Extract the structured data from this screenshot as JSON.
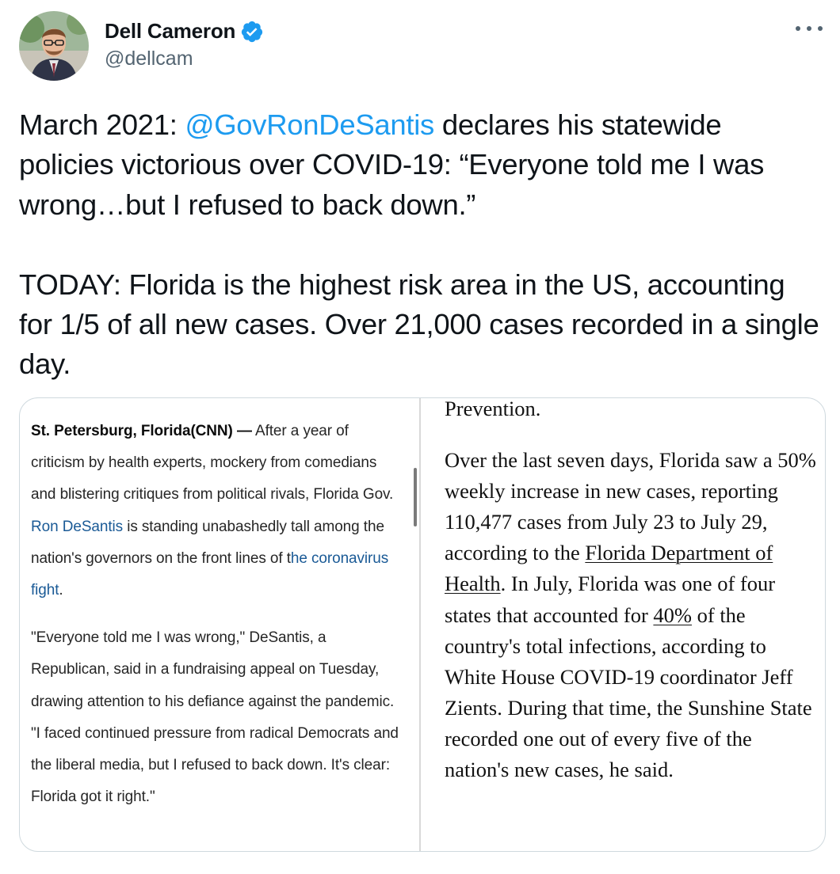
{
  "author": {
    "display_name": "Dell Cameron",
    "handle": "@dellcam",
    "verified": true,
    "avatar_icon": "avatar-photo"
  },
  "tweet": {
    "paragraph1": {
      "lead": "March 2021: ",
      "mention": "@GovRonDeSantis",
      "rest": " declares his statewide policies victorious over COVID-19: “Everyone told me I was wrong…but I refused to back down.”"
    },
    "paragraph2": "TODAY: Florida is the highest risk area in the US, accounting for 1/5 of all new cases. Over 21,000 cases recorded in a single day."
  },
  "media": {
    "left_article": {
      "dateline": "St. Petersburg, Florida(CNN) —",
      "p1_a": " After a year of criticism by health experts, mockery from comedians and blistering critiques from political rivals, Florida Gov. ",
      "p1_link1": "Ron DeSantis",
      "p1_b": " is standing unabashedly tall among the nation's governors on the front lines of t",
      "p1_link2": "he coronavirus fight",
      "p1_c": ".",
      "p2": "\"Everyone told me I was wrong,\" DeSantis, a Republican, said in a fundraising appeal on Tuesday, drawing attention to his defiance against the pandemic. \"I faced continued pressure from radical Democrats and the liberal media, but I refused to back down. It's clear: Florida got it right.\""
    },
    "right_article": {
      "p1": "Prevention.",
      "p2_a": "Over the last seven days, Florida saw a 50% weekly increase in new cases, reporting 110,477 cases from July 23 to July 29, according to the ",
      "p2_link1": "Florida Department of Health",
      "p2_b": ". In July, Florida was one of four states that accounted for ",
      "p2_link2": "40%",
      "p2_c": " of the country's total infections, according to White House COVID-19 coordinator Jeff Zients. During that time, the Sunshine State recorded one out of every five of the nation's new cases, he said."
    }
  },
  "colors": {
    "accent": "#1d9bf0",
    "secondary_text": "#536471",
    "cnn_link": "#1a5a96"
  }
}
